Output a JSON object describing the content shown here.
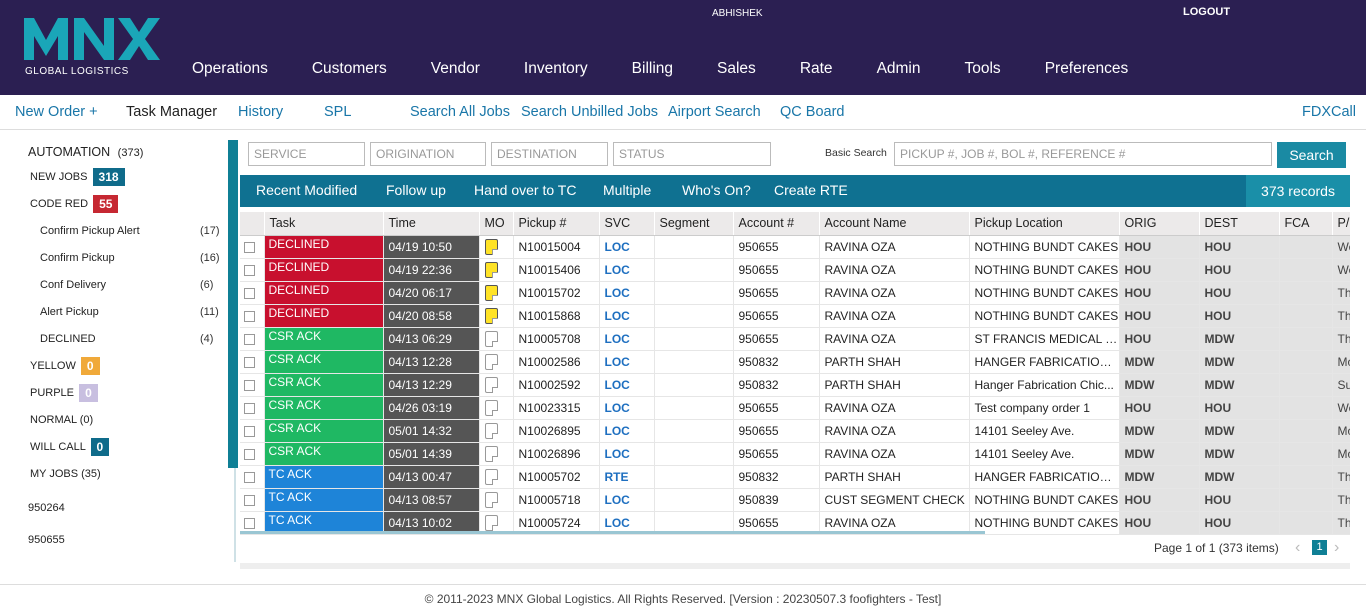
{
  "header": {
    "logo_text": "MNX",
    "logo_sub": "GLOBAL LOGISTICS",
    "user": "ABHISHEK",
    "logout": "LOGOUT",
    "nav": [
      "Operations",
      "Customers",
      "Vendor",
      "Inventory",
      "Billing",
      "Sales",
      "Rate",
      "Admin",
      "Tools",
      "Preferences"
    ]
  },
  "subnav": {
    "new_order": "New Order +",
    "task_manager": "Task Manager",
    "history": "History",
    "spl": "SPL",
    "search_all": "Search All Jobs",
    "search_unbilled": "Search Unbilled Jobs",
    "airport_search": "Airport Search",
    "qc_board": "QC Board",
    "fdxcall": "FDXCall"
  },
  "sidebar": {
    "automation": "AUTOMATION",
    "automation_count": "(373)",
    "new_jobs": "NEW JOBS",
    "new_jobs_count": "318",
    "code_red": "CODE RED",
    "code_red_count": "55",
    "sub_items": [
      {
        "label": "Confirm Pickup Alert",
        "count": "(17)"
      },
      {
        "label": "Confirm Pickup",
        "count": "(16)"
      },
      {
        "label": "Conf Delivery",
        "count": "(6)"
      },
      {
        "label": "Alert Pickup",
        "count": "(11)"
      },
      {
        "label": "DECLINED",
        "count": "(4)"
      }
    ],
    "yellow": "YELLOW",
    "yellow_count": "0",
    "purple": "PURPLE",
    "purple_count": "0",
    "normal": "NORMAL (0)",
    "will_call": "WILL CALL",
    "will_call_count": "0",
    "my_jobs": "MY JOBS (35)",
    "account_1": "950264",
    "account_2": "950655",
    "colors": {
      "new_jobs": "#0f6b8a",
      "code_red": "#c62832",
      "yellow": "#f0a93a",
      "purple": "#c8bfe0",
      "will_call": "#0f6b8a"
    }
  },
  "filters": {
    "service": "SERVICE",
    "origination": "ORIGINATION",
    "destination": "DESTINATION",
    "status": "STATUS",
    "basic_search_label": "Basic Search",
    "basic_search_placeholder": "PICKUP #, JOB #, BOL #, REFERENCE #",
    "search_button": "Search"
  },
  "actions": {
    "recent_modified": "Recent Modified",
    "follow_up": "Follow up",
    "hand_over": "Hand over to TC",
    "multiple": "Multiple",
    "whos_on": "Who's On?",
    "create_rte": "Create RTE",
    "records": "373 records"
  },
  "grid": {
    "columns": [
      "",
      "Task",
      "Time",
      "MO",
      "Pickup #",
      "SVC",
      "Segment",
      "Account #",
      "Account Name",
      "Pickup Location",
      "ORIG",
      "DEST",
      "FCA",
      "P/"
    ],
    "rows": [
      {
        "task": "DECLINED",
        "task_color": "#c8102e",
        "time": "04/19 10:50",
        "mo": "yellow",
        "pickup": "N10015004",
        "svc": "LOC",
        "segment": "",
        "account": "950655",
        "name": "RAVINA OZA",
        "location": "NOTHING BUNDT CAKES",
        "orig": "HOU",
        "dest": "HOU",
        "fca": "",
        "p": "We"
      },
      {
        "task": "DECLINED",
        "task_color": "#c8102e",
        "time": "04/19 22:36",
        "mo": "yellow",
        "pickup": "N10015406",
        "svc": "LOC",
        "segment": "",
        "account": "950655",
        "name": "RAVINA OZA",
        "location": "NOTHING BUNDT CAKES",
        "orig": "HOU",
        "dest": "HOU",
        "fca": "",
        "p": "We"
      },
      {
        "task": "DECLINED",
        "task_color": "#c8102e",
        "time": "04/20 06:17",
        "mo": "yellow",
        "pickup": "N10015702",
        "svc": "LOC",
        "segment": "",
        "account": "950655",
        "name": "RAVINA OZA",
        "location": "NOTHING BUNDT CAKES",
        "orig": "HOU",
        "dest": "HOU",
        "fca": "",
        "p": "Th"
      },
      {
        "task": "DECLINED",
        "task_color": "#c8102e",
        "time": "04/20 08:58",
        "mo": "yellow",
        "pickup": "N10015868",
        "svc": "LOC",
        "segment": "",
        "account": "950655",
        "name": "RAVINA OZA",
        "location": "NOTHING BUNDT CAKES",
        "orig": "HOU",
        "dest": "HOU",
        "fca": "",
        "p": "Th"
      },
      {
        "task": "CSR ACK",
        "task_color": "#1fb863",
        "time": "04/13 06:29",
        "mo": "white",
        "pickup": "N10005708",
        "svc": "LOC",
        "segment": "",
        "account": "950655",
        "name": "RAVINA OZA",
        "location": "ST FRANCIS MEDICAL C...",
        "orig": "HOU",
        "dest": "MDW",
        "fca": "",
        "p": "Th"
      },
      {
        "task": "CSR ACK",
        "task_color": "#1fb863",
        "time": "04/13 12:28",
        "mo": "white",
        "pickup": "N10002586",
        "svc": "LOC",
        "segment": "",
        "account": "950832",
        "name": "PARTH SHAH",
        "location": "HANGER FABRICATION ...",
        "orig": "MDW",
        "dest": "MDW",
        "fca": "",
        "p": "Mo"
      },
      {
        "task": "CSR ACK",
        "task_color": "#1fb863",
        "time": "04/13 12:29",
        "mo": "white",
        "pickup": "N10002592",
        "svc": "LOC",
        "segment": "",
        "account": "950832",
        "name": "PARTH SHAH",
        "location": "Hanger Fabrication Chic...",
        "orig": "MDW",
        "dest": "MDW",
        "fca": "",
        "p": "Su"
      },
      {
        "task": "CSR ACK",
        "task_color": "#1fb863",
        "time": "04/26 03:19",
        "mo": "white",
        "pickup": "N10023315",
        "svc": "LOC",
        "segment": "",
        "account": "950655",
        "name": "RAVINA OZA",
        "location": "Test company order 1",
        "orig": "HOU",
        "dest": "HOU",
        "fca": "",
        "p": "We"
      },
      {
        "task": "CSR ACK",
        "task_color": "#1fb863",
        "time": "05/01 14:32",
        "mo": "white",
        "pickup": "N10026895",
        "svc": "LOC",
        "segment": "",
        "account": "950655",
        "name": "RAVINA OZA",
        "location": "14101 Seeley Ave.",
        "orig": "MDW",
        "dest": "MDW",
        "fca": "",
        "p": "Mo"
      },
      {
        "task": "CSR ACK",
        "task_color": "#1fb863",
        "time": "05/01 14:39",
        "mo": "white",
        "pickup": "N10026896",
        "svc": "LOC",
        "segment": "",
        "account": "950655",
        "name": "RAVINA OZA",
        "location": "14101 Seeley Ave.",
        "orig": "MDW",
        "dest": "MDW",
        "fca": "",
        "p": "Mo"
      },
      {
        "task": "TC ACK",
        "task_color": "#1e84d8",
        "time": "04/13 00:47",
        "mo": "white",
        "pickup": "N10005702",
        "svc": "RTE",
        "segment": "",
        "account": "950832",
        "name": "PARTH SHAH",
        "location": "HANGER FABRICATION ...",
        "orig": "MDW",
        "dest": "MDW",
        "fca": "",
        "p": "Th"
      },
      {
        "task": "TC ACK",
        "task_color": "#1e84d8",
        "time": "04/13 08:57",
        "mo": "white",
        "pickup": "N10005718",
        "svc": "LOC",
        "segment": "",
        "account": "950839",
        "name": "CUST SEGMENT CHECK",
        "location": "NOTHING BUNDT CAKES",
        "orig": "HOU",
        "dest": "HOU",
        "fca": "",
        "p": "Th"
      },
      {
        "task": "TC ACK",
        "task_color": "#1e84d8",
        "time": "04/13 10:02",
        "mo": "white",
        "pickup": "N10005724",
        "svc": "LOC",
        "segment": "",
        "account": "950655",
        "name": "RAVINA OZA",
        "location": "NOTHING BUNDT CAKES",
        "orig": "HOU",
        "dest": "HOU",
        "fca": "",
        "p": "Th"
      }
    ]
  },
  "pager": {
    "text": "Page 1 of 1 (373 items)",
    "current": "1"
  },
  "footer": "© 2011-2023 MNX Global Logistics. All Rights Reserved. [Version : 20230507.3 foofighters - Test]"
}
